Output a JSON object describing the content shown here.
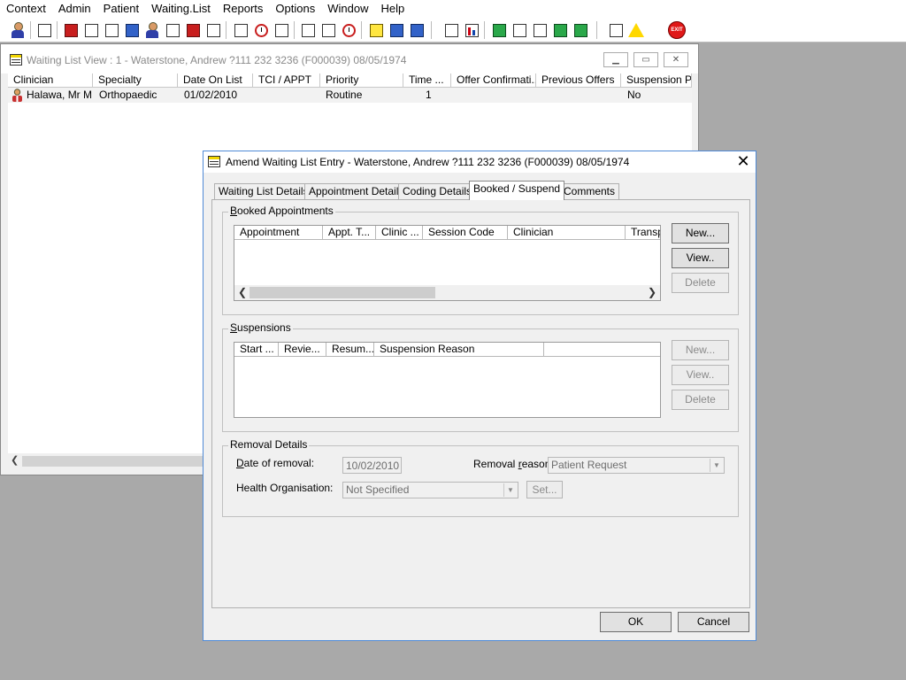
{
  "menu": [
    "Context",
    "Admin",
    "Patient",
    "Waiting.List",
    "Reports",
    "Options",
    "Window",
    "Help"
  ],
  "toolbar": {
    "exit_label": "EXIT"
  },
  "waiting_list_view": {
    "title": "Waiting List View :  1 - Waterstone, Andrew ?111 232 3236 (F000039) 08/05/1974",
    "columns": [
      "Clinician",
      "Specialty",
      "Date On List",
      "TCI / APPT",
      "Priority",
      "Time ...",
      "Offer Confirmati...",
      "Previous Offers",
      "Suspension Pe"
    ],
    "rows": [
      [
        "Halawa, Mr M",
        "Orthopaedic",
        "01/02/2010",
        "",
        "Routine",
        "1",
        "",
        "",
        "No"
      ]
    ]
  },
  "dialog": {
    "title": "Amend Waiting List Entry - Waterstone, Andrew ?111 232 3236 (F000039) 08/05/1974",
    "tabs": [
      "Waiting List Details",
      "Appointment Details",
      "Coding Details",
      "Booked / Suspend",
      "Comments"
    ],
    "active_tab": "Booked / Suspend",
    "booked": {
      "legend": "Booked Appointments",
      "columns": [
        "Appointment",
        "Appt. T...",
        "Clinic ...",
        "Session Code",
        "Clinician",
        "Transp"
      ],
      "buttons": {
        "new": "New...",
        "view": "View..",
        "delete": "Delete"
      }
    },
    "suspensions": {
      "legend": "Suspensions",
      "columns": [
        "Start ...",
        "Revie...",
        "Resum...",
        "Suspension Reason",
        ""
      ],
      "buttons": {
        "new": "New...",
        "view": "View..",
        "delete": "Delete"
      }
    },
    "removal": {
      "legend": "Removal Details",
      "date_label": "Date of removal:",
      "date_value": "10/02/2010",
      "reason_label": "Removal reason:",
      "reason_value": "Patient Request",
      "org_label": "Health Organisation:",
      "org_value": "Not Specified",
      "set_button": "Set..."
    },
    "ok_label": "OK",
    "cancel_label": "Cancel"
  }
}
